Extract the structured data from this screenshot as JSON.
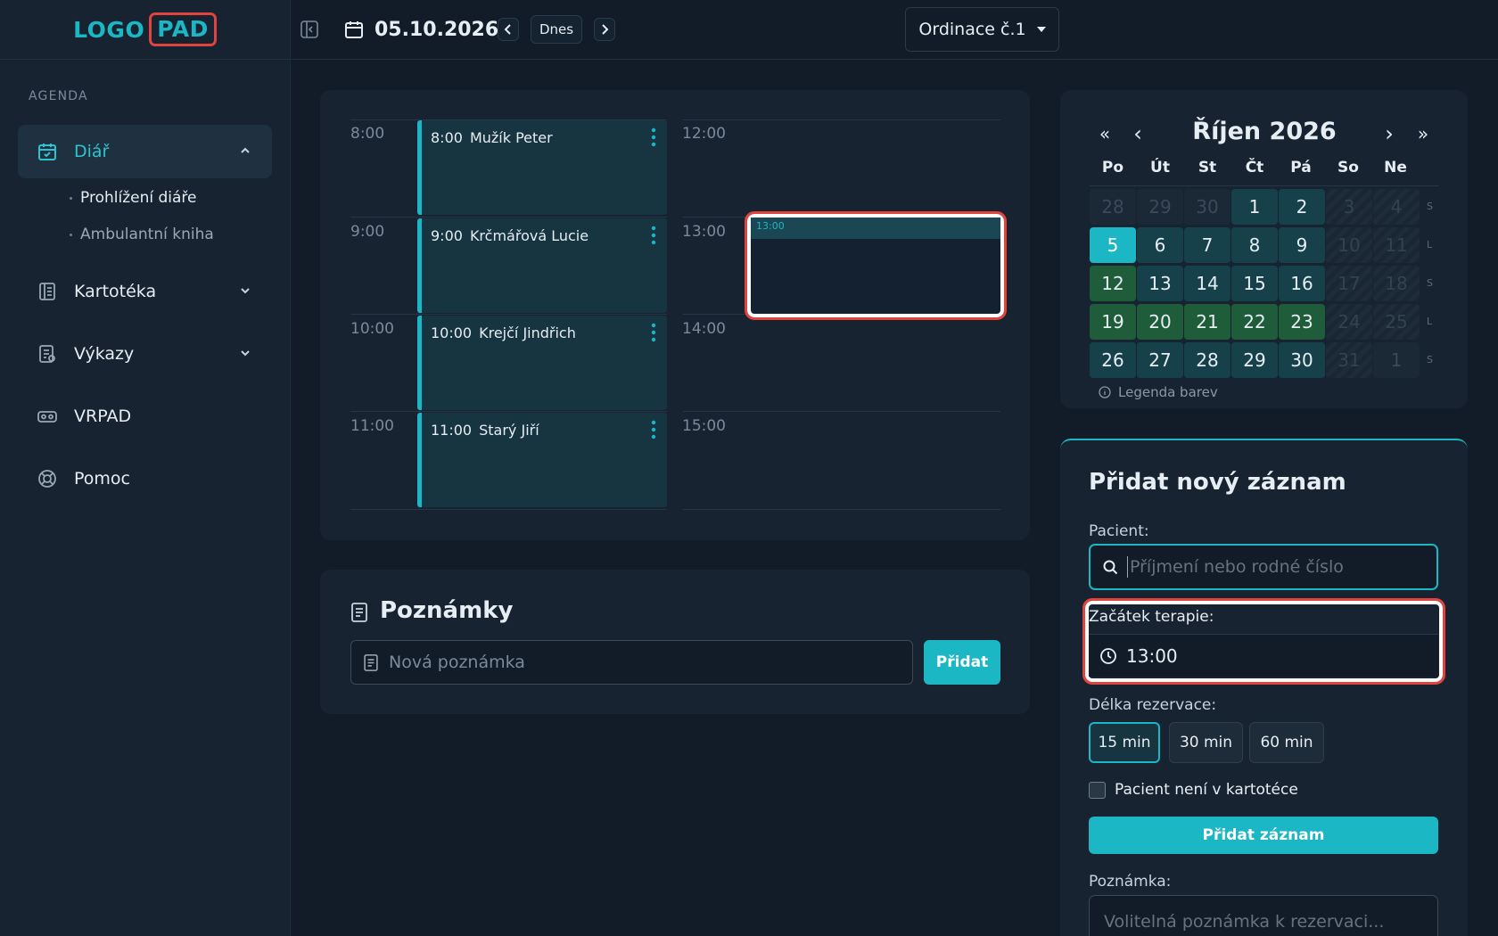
{
  "logo": {
    "part1": "LOGO",
    "part2": "PAD"
  },
  "sidebar": {
    "section": "AGENDA",
    "items": [
      {
        "label": "Diář",
        "icon": "calendar-check-icon",
        "expanded": true
      },
      {
        "label": "Kartotéka",
        "icon": "book-icon",
        "expanded": false
      },
      {
        "label": "Výkazy",
        "icon": "report-icon",
        "expanded": false
      },
      {
        "label": "VRPAD",
        "icon": "vr-headset-icon"
      },
      {
        "label": "Pomoc",
        "icon": "lifebuoy-icon"
      }
    ],
    "subitems": [
      {
        "label": "Prohlížení diáře",
        "active": true
      },
      {
        "label": "Ambulantní kniha",
        "active": false
      }
    ]
  },
  "topbar": {
    "date": "05.10.2026",
    "today": "Dnes",
    "office": "Ordinace č.1"
  },
  "schedule": {
    "left_times": [
      "8:00",
      "9:00",
      "10:00",
      "11:00"
    ],
    "right_times": [
      "12:00",
      "13:00",
      "14:00",
      "15:00"
    ],
    "appointments": [
      {
        "time": "8:00",
        "name": "Mužík Peter"
      },
      {
        "time": "9:00",
        "name": "Krčmářová Lucie"
      },
      {
        "time": "10:00",
        "name": "Krejčí Jindřich"
      },
      {
        "time": "11:00",
        "name": "Starý Jiří"
      }
    ],
    "selected_slot": "13:00"
  },
  "notes": {
    "title": "Poznámky",
    "placeholder": "Nová poznámka",
    "add": "Přidat"
  },
  "mini_calendar": {
    "title": "Říjen 2026",
    "nav": {
      "prev_year": "«",
      "prev": "‹",
      "next": "›",
      "next_year": "»"
    },
    "weekdays": [
      "Po",
      "Út",
      "St",
      "Čt",
      "Pá",
      "So",
      "Ne"
    ],
    "weeks": [
      {
        "days": [
          "28",
          "29",
          "30",
          "1",
          "2",
          "3",
          "4"
        ],
        "parity": "S"
      },
      {
        "days": [
          "5",
          "6",
          "7",
          "8",
          "9",
          "10",
          "11"
        ],
        "parity": "L"
      },
      {
        "days": [
          "12",
          "13",
          "14",
          "15",
          "16",
          "17",
          "18"
        ],
        "parity": "S"
      },
      {
        "days": [
          "19",
          "20",
          "21",
          "22",
          "23",
          "24",
          "25"
        ],
        "parity": "L"
      },
      {
        "days": [
          "26",
          "27",
          "28",
          "29",
          "30",
          "31",
          "1"
        ],
        "parity": "S"
      }
    ],
    "legend": "Legenda barev",
    "colors": {
      "today": "#1bb7c4",
      "green": "#1f5c3a",
      "teal": "#17414a"
    }
  },
  "form": {
    "title": "Přidat nový záznam",
    "patient_label": "Pacient:",
    "patient_placeholder": "Příjmení nebo rodné číslo",
    "start_label": "Začátek terapie:",
    "start_value": "13:00",
    "duration_label": "Délka rezervace:",
    "durations": [
      "15 min",
      "30 min",
      "60 min"
    ],
    "not_in_file": "Pacient není v kartotéce",
    "submit": "Přidat záznam",
    "note_label": "Poznámka:",
    "note_placeholder": "Volitelná poznámka k rezervaci..."
  },
  "colors": {
    "accent": "#1bb7c4",
    "highlight": "#e0443c",
    "background": "#111c28",
    "panel": "#172331"
  }
}
